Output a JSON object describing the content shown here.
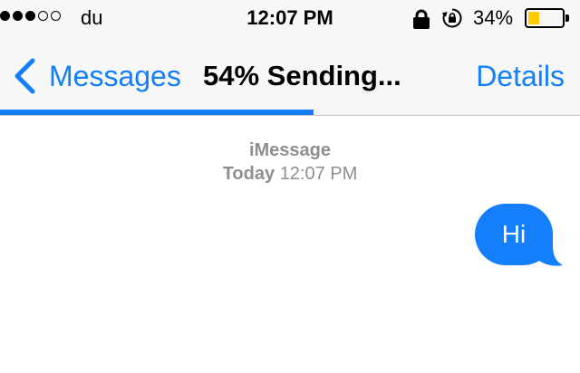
{
  "status_bar": {
    "signal_bars_filled": 3,
    "signal_bars_total": 5,
    "carrier": "du",
    "time": "12:07 PM",
    "lock_icon": "lock-icon",
    "rotation_icon": "rotation-lock-icon",
    "battery_percent": "34%",
    "battery_level": 0.34,
    "battery_color": "#ffcc00"
  },
  "nav": {
    "back_label": "Messages",
    "title": "54% Sending...",
    "details_label": "Details",
    "send_progress": 0.54,
    "accent_color": "#147efb"
  },
  "conversation": {
    "service": "iMessage",
    "timestamp_day": "Today",
    "timestamp_time": "12:07 PM",
    "messages": [
      {
        "direction": "outgoing",
        "text": "Hi",
        "bubble_color": "#147efb"
      }
    ]
  }
}
